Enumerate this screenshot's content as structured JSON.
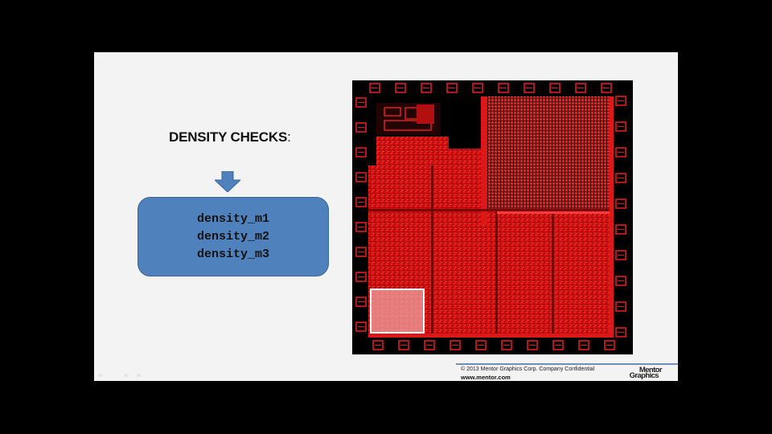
{
  "slide": {
    "title": "DENSITY CHECKS",
    "title_colon": ":",
    "checks": [
      "density_m1",
      "density_m2",
      "density_m3"
    ],
    "box_color": "#4f81bd",
    "arrow_color": "#4f81bd"
  },
  "layout_image": {
    "die_color": "#d41414",
    "background": "#000000",
    "highlight_color": "#ffffff",
    "highlighted_region": "density window"
  },
  "footer": {
    "copyright": "© 2013 Mentor Graphics Corp. Company Confidential",
    "website": "www.mentor.com",
    "logo_line1": "Mentor",
    "logo_line2": "Graphics"
  }
}
